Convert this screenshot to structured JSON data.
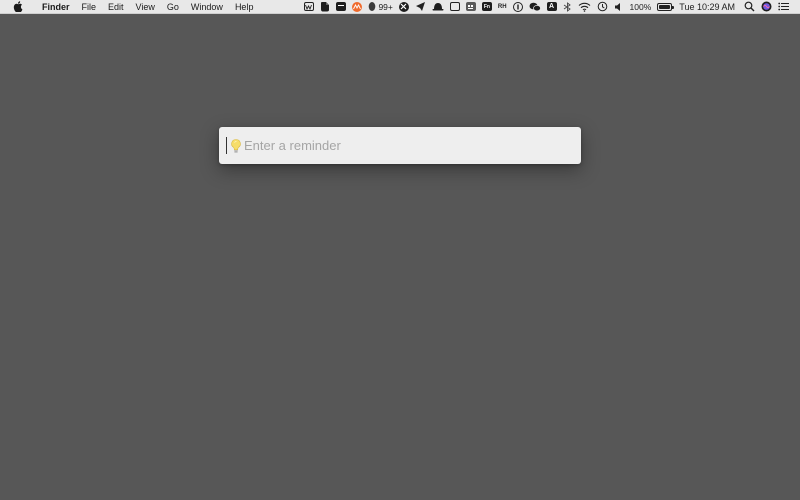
{
  "menubar": {
    "app_name": "Finder",
    "menus": [
      "File",
      "Edit",
      "View",
      "Go",
      "Window",
      "Help"
    ],
    "status": {
      "notification_count": "99+",
      "fn_label": "Fn",
      "rh_label": "RH",
      "a_label": "A",
      "battery_percent": "100%",
      "clock": "Tue 10:29 AM"
    }
  },
  "reminder": {
    "placeholder": "Enter a reminder",
    "value": ""
  },
  "colors": {
    "desktop": "#575757",
    "menubar": "#e8e8e8",
    "input_bg": "#eeeeee",
    "placeholder": "#a5a5a5",
    "accent_orange": "#f06a2c"
  }
}
